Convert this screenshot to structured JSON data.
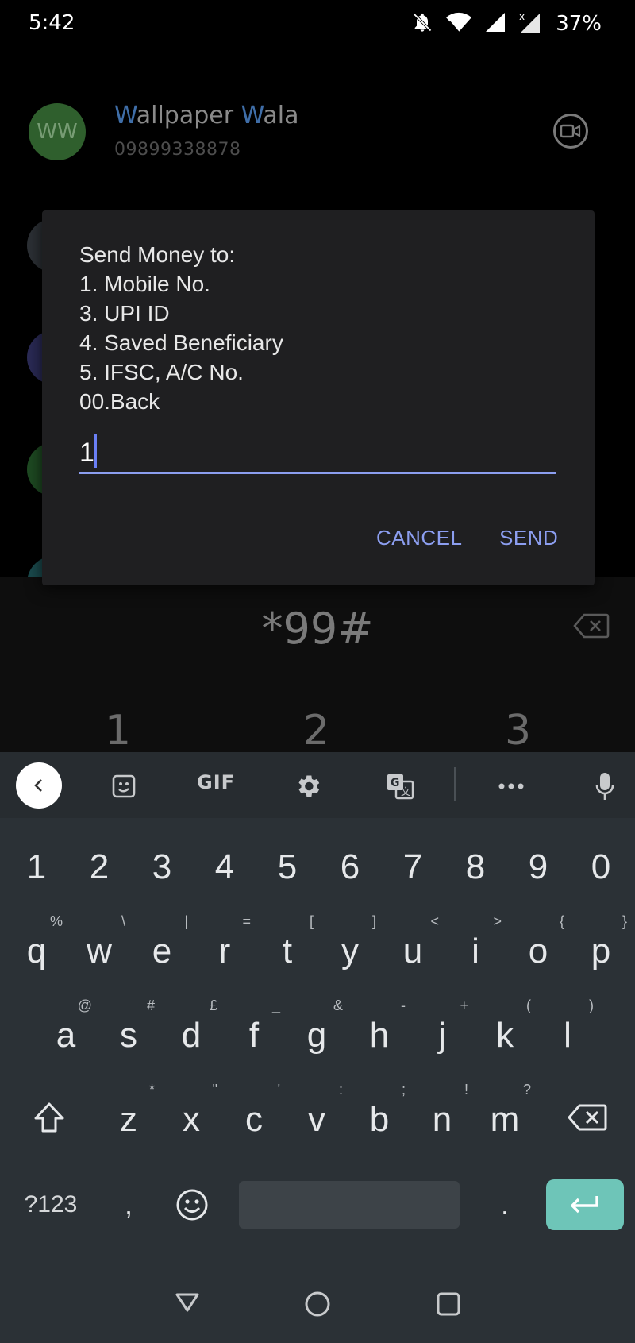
{
  "status_bar": {
    "time": "5:42",
    "battery": "37%",
    "icons": [
      "bell-off-icon",
      "wifi-icon",
      "signal-icon",
      "signal-x-icon"
    ]
  },
  "background_contact": {
    "initials": "WW",
    "name_parts": [
      "W",
      "allpaper ",
      "W",
      "ala"
    ],
    "number": "09899338878"
  },
  "dialog": {
    "lines": [
      "Send Money to:",
      "1. Mobile No.",
      "3. UPI ID",
      "4. Saved Beneficiary",
      "5. IFSC, A/C No.",
      "00.Back"
    ],
    "input_value": "1",
    "cancel_label": "CANCEL",
    "send_label": "SEND"
  },
  "dialer": {
    "number": "*99#",
    "digits": [
      "1",
      "2",
      "3"
    ]
  },
  "keyboard": {
    "toolbar": {
      "gif_label": "GIF"
    },
    "number_row": [
      "1",
      "2",
      "3",
      "4",
      "5",
      "6",
      "7",
      "8",
      "9",
      "0"
    ],
    "row1": [
      {
        "key": "q",
        "hint": "%"
      },
      {
        "key": "w",
        "hint": "\\"
      },
      {
        "key": "e",
        "hint": "|"
      },
      {
        "key": "r",
        "hint": "="
      },
      {
        "key": "t",
        "hint": "["
      },
      {
        "key": "y",
        "hint": "]"
      },
      {
        "key": "u",
        "hint": "<"
      },
      {
        "key": "i",
        "hint": ">"
      },
      {
        "key": "o",
        "hint": "{"
      },
      {
        "key": "p",
        "hint": "}"
      }
    ],
    "row2": [
      {
        "key": "a",
        "hint": "@"
      },
      {
        "key": "s",
        "hint": "#"
      },
      {
        "key": "d",
        "hint": "£"
      },
      {
        "key": "f",
        "hint": "_"
      },
      {
        "key": "g",
        "hint": "&"
      },
      {
        "key": "h",
        "hint": "-"
      },
      {
        "key": "j",
        "hint": "+"
      },
      {
        "key": "k",
        "hint": "("
      },
      {
        "key": "l",
        "hint": ")"
      }
    ],
    "row3": [
      {
        "key": "z",
        "hint": "*"
      },
      {
        "key": "x",
        "hint": "\""
      },
      {
        "key": "c",
        "hint": "'"
      },
      {
        "key": "v",
        "hint": ":"
      },
      {
        "key": "b",
        "hint": ";"
      },
      {
        "key": "n",
        "hint": "!"
      },
      {
        "key": "m",
        "hint": "?"
      }
    ],
    "symbols_label": "?123",
    "comma": ",",
    "period": "."
  },
  "colors": {
    "accent": "#8c9ef0",
    "enter_key": "#6ec5b8",
    "keyboard_bg": "#2b3136",
    "dialog_bg": "#1f1f21"
  }
}
